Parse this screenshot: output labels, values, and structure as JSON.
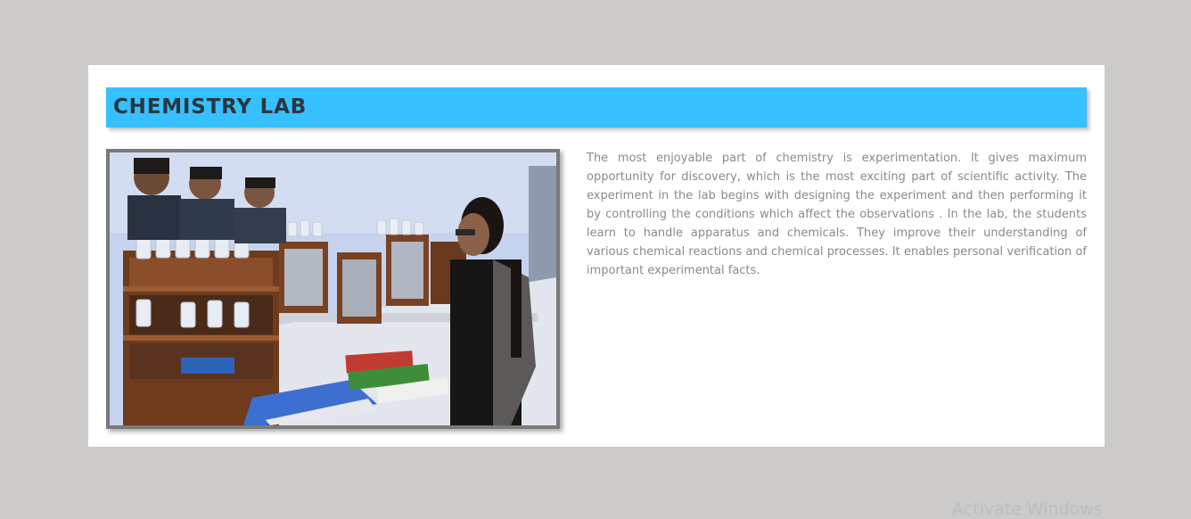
{
  "section": {
    "title": "CHEMISTRY LAB",
    "description": "The most enjoyable part of chemistry is experimentation. It gives maximum opportunity for discovery, which is the most exciting part of scientific activity. The experiment in the lab begins with designing the experiment and then performing it by controlling the conditions which affect the observations . In the lab, the students learn to handle apparatus and chemicals. They improve their understanding of various chemical reactions and chemical processes. It enables personal verification of important experimental facts."
  },
  "photo": {
    "subject": "students-in-chemistry-lab"
  },
  "overlay": {
    "watermark_text": "Activate Windows"
  },
  "colors": {
    "page_background": "#cccbc9",
    "card_background": "#ffffff",
    "title_bar": "#36c0fd",
    "title_text": "#2b3640",
    "body_text": "#8a8a8a",
    "photo_border": "#7a7a7a"
  }
}
